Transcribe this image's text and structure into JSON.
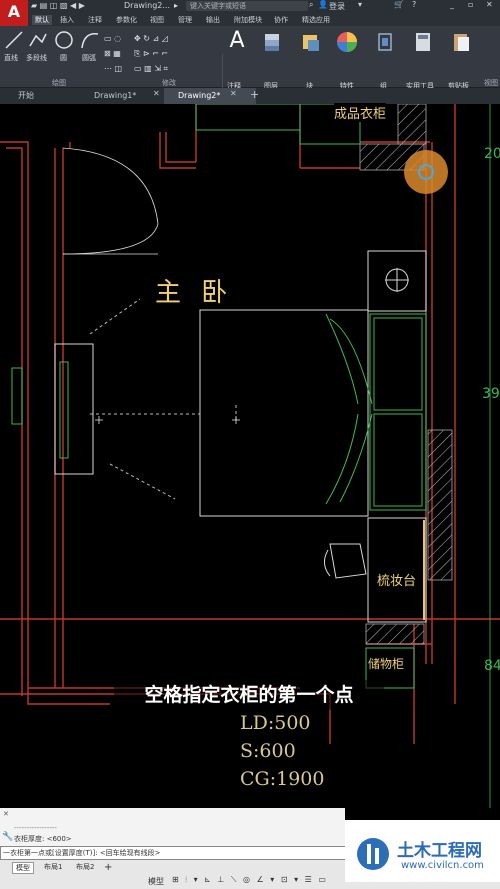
{
  "titlebar": {
    "doc_title": "Drawing2...",
    "search_placeholder": "键入关键字或短语",
    "login": "登录"
  },
  "menu": {
    "tabs": [
      "默认",
      "插入",
      "注释",
      "参数化",
      "视图",
      "管理",
      "输出",
      "附加模块",
      "协作",
      "精选应用"
    ]
  },
  "ribbon": {
    "tools": [
      "直线",
      "多段线",
      "圆",
      "圆弧"
    ],
    "big_tools": [
      "注释",
      "图层",
      "块",
      "特性",
      "组",
      "实用工具",
      "剪贴板"
    ],
    "panels": [
      "绘图",
      "修改",
      "视图"
    ]
  },
  "doc_tabs": [
    "开始",
    "Drawing1*",
    "Drawing2*"
  ],
  "drawing": {
    "room_label": "主 卧",
    "wardrobe_label": "成品衣柜",
    "vanity_label": "梳妆台",
    "storage_label": "储物柜",
    "dim_right_1": "20",
    "dim_right_2": "39",
    "dim_right_3": "84"
  },
  "subtitle": "空格指定衣柜的第一个点",
  "params": {
    "ld": "LD:500",
    "s": "S:600",
    "cg": "CG:1900"
  },
  "command": {
    "dashes": "-----------------",
    "line1": "衣柜厚度: <600>",
    "prompt": "一衣柜第一点或[设置厚度(T)]: <回车绘现有线段>"
  },
  "status": {
    "tabs": [
      "模型",
      "布局1",
      "布局2"
    ],
    "model": "模型"
  },
  "watermark": {
    "name": "土木工程网",
    "url": "www.civilcn.com"
  },
  "colors": {
    "accent_red": "#c21d1d",
    "wall_red": "#c0392b",
    "furniture_green": "#3fb950",
    "text_yellow": "#f0d070"
  }
}
